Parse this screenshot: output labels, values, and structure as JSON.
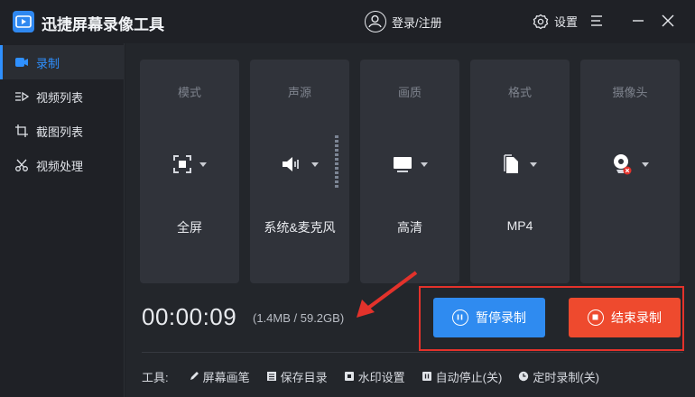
{
  "app": {
    "title": "迅捷屏幕录像工具"
  },
  "header": {
    "login_label": "登录/注册",
    "settings_label": "设置"
  },
  "sidebar": {
    "items": [
      {
        "label": "录制",
        "icon": "video-camera-icon"
      },
      {
        "label": "视频列表",
        "icon": "video-list-icon"
      },
      {
        "label": "截图列表",
        "icon": "screenshot-list-icon"
      },
      {
        "label": "视频处理",
        "icon": "video-edit-icon"
      }
    ],
    "active_index": 0
  },
  "cards": [
    {
      "title": "模式",
      "value": "全屏",
      "icon": "fullscreen-icon"
    },
    {
      "title": "声源",
      "value": "系统&麦克风",
      "icon": "speaker-icon"
    },
    {
      "title": "画质",
      "value": "高清",
      "icon": "monitor-icon"
    },
    {
      "title": "格式",
      "value": "MP4",
      "icon": "file-icon"
    },
    {
      "title": "摄像头",
      "value": "",
      "icon": "webcam-off-icon"
    }
  ],
  "recording": {
    "timer": "00:00:09",
    "size_info": "(1.4MB / 59.2GB)",
    "pause_label": "暂停录制",
    "stop_label": "结束录制"
  },
  "tools": {
    "label": "工具:",
    "items": [
      {
        "label": "屏幕画笔",
        "icon": "pen-icon"
      },
      {
        "label": "保存目录",
        "icon": "folder-icon"
      },
      {
        "label": "水印设置",
        "icon": "watermark-icon"
      },
      {
        "label": "自动停止(关)",
        "icon": "auto-stop-icon"
      },
      {
        "label": "定时录制(关)",
        "icon": "clock-icon"
      }
    ]
  },
  "colors": {
    "accent": "#2f90ff",
    "pause_button": "#2f8bf0",
    "stop_button": "#ee4a2e",
    "highlight": "#e3322b"
  }
}
